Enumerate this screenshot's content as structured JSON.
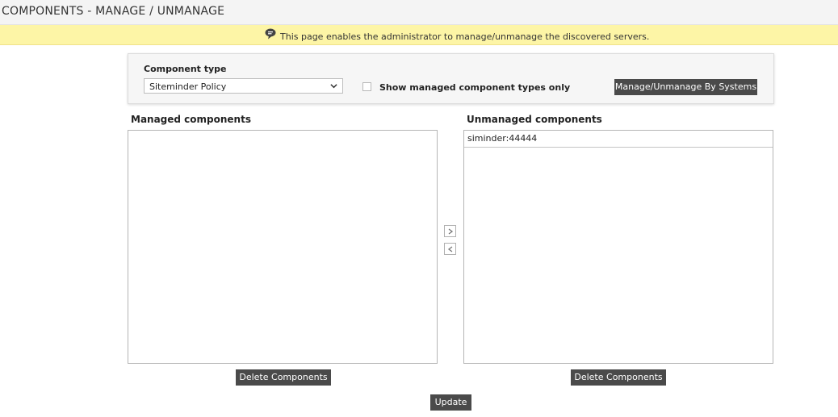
{
  "header": {
    "title": "COMPONENTS - MANAGE / UNMANAGE"
  },
  "info_bar": {
    "icon": "speech-bubble-icon",
    "message": "This page enables the administrator to manage/unmanage the discovered servers."
  },
  "filter": {
    "component_type_label": "Component type",
    "component_type_value": "Siteminder Policy",
    "show_managed_only_label": "Show managed component types only",
    "show_managed_only_checked": false,
    "manage_by_systems_label": "Manage/Unmanage By Systems"
  },
  "managed": {
    "heading": "Managed components",
    "items": [],
    "delete_label": "Delete Components"
  },
  "unmanaged": {
    "heading": "Unmanaged components",
    "items": [
      "siminder:44444"
    ],
    "delete_label": "Delete Components"
  },
  "move_buttons": {
    "to_managed_icon": "chevron-right-icon",
    "to_unmanaged_icon": "chevron-left-icon"
  },
  "actions": {
    "update_label": "Update"
  },
  "colors": {
    "info_bar_bg": "#fdf5a6",
    "button_bg": "#4a4a4a"
  }
}
